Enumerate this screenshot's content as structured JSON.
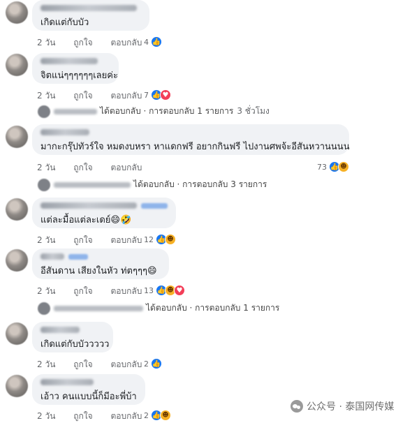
{
  "labels": {
    "like": "ถูกใจ",
    "reply": "ตอบกลับ"
  },
  "comments": [
    {
      "text": "เกิดแต่กับบัว",
      "time": "2 วัน",
      "count": "4",
      "reactions": [
        "like"
      ]
    },
    {
      "text": "จิตแน่ๆๆๆๆๆๆเลยค่ะ",
      "time": "2 วัน",
      "count": "7",
      "reactions": [
        "like",
        "love"
      ],
      "reply_summary": "ได้ตอบกลับ · การตอบกลับ 1 รายการ",
      "reply_age": "3 ชั่วโมง"
    },
    {
      "text": "มากะกรุ๊ปทัวร์ใจ หมดงบหรา หาแดกฟรี อยากกินฟรี ไปงานศพจ้ะอีสันหวานนนน",
      "time": "2 วัน",
      "count": "73",
      "reactions": [
        "like",
        "haha"
      ],
      "reply_summary": "ได้ตอบกลับ · การตอบกลับ 3 รายการ"
    },
    {
      "text": "แต่ละมื้อแต่ละเดย์",
      "time": "2 วัน",
      "count": "12",
      "reactions": [
        "like",
        "haha"
      ]
    },
    {
      "text": "อีสันดาน เสียงในหัว ท่ตๆๆๆ",
      "time": "2 วัน",
      "count": "13",
      "reactions": [
        "like",
        "haha",
        "love"
      ],
      "reply_summary": "ได้ตอบกลับ · การตอบกลับ 1 รายการ"
    },
    {
      "text": "เกิดแต่กับบัววววว",
      "time": "2 วัน",
      "count": "2",
      "reactions": [
        "like"
      ]
    },
    {
      "text": "เอ้าว คนแบบนี้ก็มีอะพี่บ้า",
      "time": "2 วัน",
      "count": "2",
      "reactions": [
        "like",
        "haha"
      ]
    }
  ],
  "watermark": "公众号 · 泰国网传媒",
  "colors": {
    "like": "#1877f2",
    "love": "#f33e58",
    "haha": "#f7b125",
    "bubble": "#f0f2f5",
    "meta": "#65676b"
  }
}
